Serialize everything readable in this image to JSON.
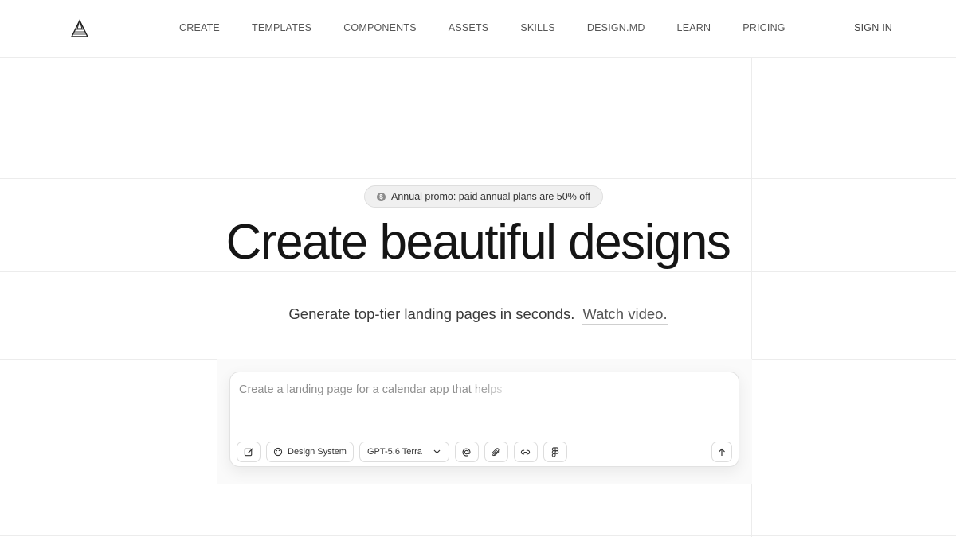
{
  "header": {
    "logo_icon": "pyramid-logo-icon",
    "nav": [
      "CREATE",
      "TEMPLATES",
      "COMPONENTS",
      "ASSETS",
      "SKILLS",
      "DESIGN.MD",
      "LEARN",
      "PRICING"
    ],
    "sign_in": "SIGN IN"
  },
  "promo": {
    "icon": "dollar-coin-icon",
    "text": "Annual promo: paid annual plans are 50% off"
  },
  "hero": {
    "title": "Create beautiful designs",
    "subtitle": "Generate top-tier landing pages in seconds.",
    "watch_link": "Watch video."
  },
  "prompt": {
    "placeholder": "Create a landing page for a calendar app that helps",
    "toolbar": {
      "edit_icon": "edit-icon",
      "design_system_label": "Design System",
      "model_label": "GPT-5.6 Terra",
      "mention_icon": "at-icon",
      "attach_icon": "paperclip-icon",
      "link_icon": "link-icon",
      "figma_icon": "figma-icon"
    },
    "send_icon": "arrow-up-icon"
  },
  "colors": {
    "background": "#ffffff",
    "grid_line": "#ececec",
    "text": "#151515",
    "muted_text": "#555555"
  }
}
